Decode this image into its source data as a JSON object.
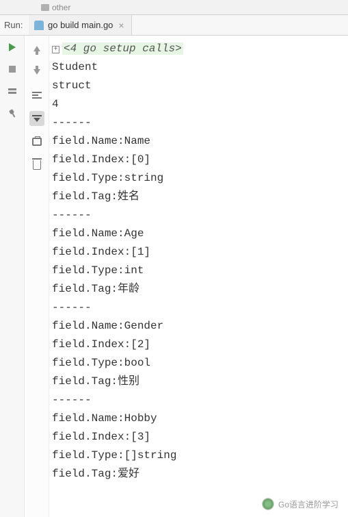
{
  "topbar": {
    "breadcrumb": "other"
  },
  "run": {
    "label": "Run:"
  },
  "tab": {
    "label": "go build main.go"
  },
  "fold": {
    "symbol": "+"
  },
  "setup_line": "<4 go setup calls>",
  "output_lines": [
    "Student",
    "struct",
    "4",
    "------",
    "field.Name:Name",
    "field.Index:[0]",
    "field.Type:string",
    "field.Tag:姓名",
    "------",
    "field.Name:Age",
    "field.Index:[1]",
    "field.Type:int",
    "field.Tag:年龄",
    "------",
    "field.Name:Gender",
    "field.Index:[2]",
    "field.Type:bool",
    "field.Tag:性别",
    "------",
    "field.Name:Hobby",
    "field.Index:[3]",
    "field.Type:[]string",
    "field.Tag:爱好"
  ],
  "watermark": {
    "text": "Go语言进阶学习"
  }
}
